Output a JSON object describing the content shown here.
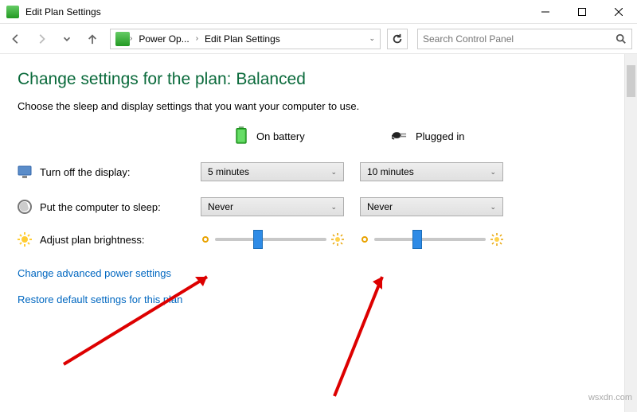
{
  "titlebar": {
    "title": "Edit Plan Settings"
  },
  "nav": {
    "crumb1": "Power Op...",
    "crumb2": "Edit Plan Settings",
    "search_placeholder": "Search Control Panel"
  },
  "page": {
    "heading": "Change settings for the plan: Balanced",
    "desc": "Choose the sleep and display settings that you want your computer to use.",
    "cols": {
      "battery": "On battery",
      "plugged": "Plugged in"
    },
    "rows": {
      "display": {
        "label": "Turn off the display:",
        "battery": "5 minutes",
        "plugged": "10 minutes"
      },
      "sleep": {
        "label": "Put the computer to sleep:",
        "battery": "Never",
        "plugged": "Never"
      },
      "bright": {
        "label": "Adjust plan brightness:"
      }
    },
    "links": {
      "advanced": "Change advanced power settings",
      "restore": "Restore default settings for this plan"
    }
  },
  "watermark": "wsxdn.com"
}
